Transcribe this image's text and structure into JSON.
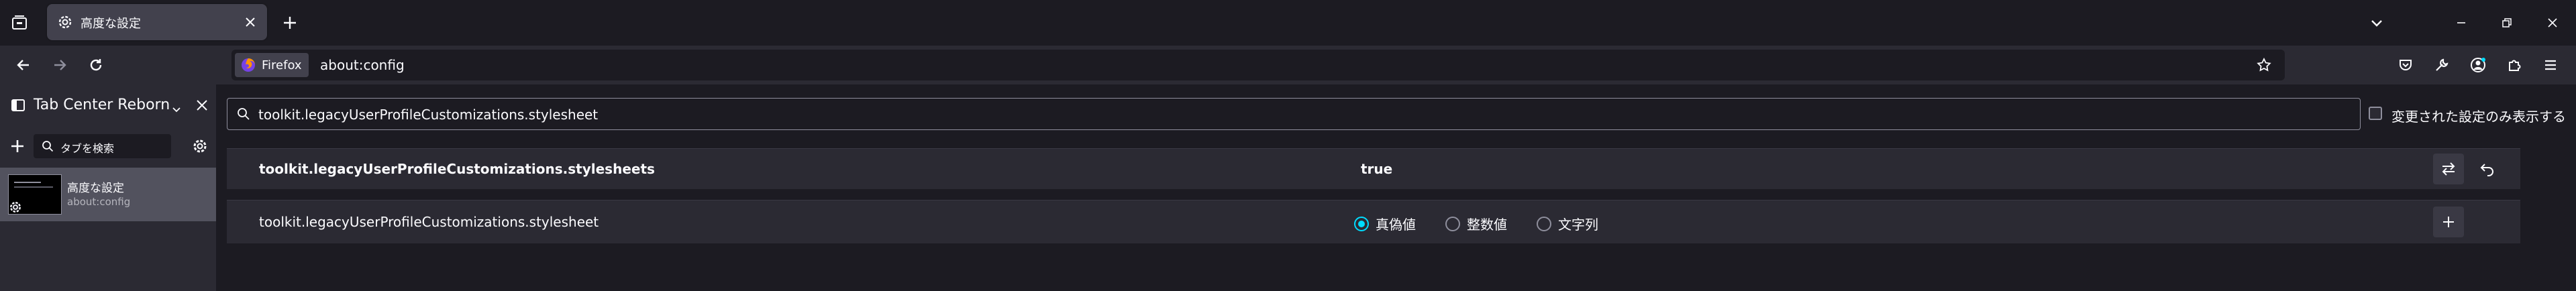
{
  "tab": {
    "title": "高度な設定"
  },
  "urlbar": {
    "identity_label": "Firefox",
    "url": "about:config"
  },
  "sidebar": {
    "title": "Tab Center Reborn",
    "search_placeholder": "タブを検索",
    "tabs": [
      {
        "title": "高度な設定",
        "url": "about:config"
      }
    ]
  },
  "config": {
    "search_value": "toolkit.legacyUserProfileCustomizations.stylesheet",
    "modified_only_label": "変更された設定のみ表示する",
    "rows": [
      {
        "name": "toolkit.legacyUserProfileCustomizations.stylesheets",
        "value": "true"
      },
      {
        "name": "toolkit.legacyUserProfileCustomizations.stylesheet",
        "types": [
          "真偽値",
          "整数値",
          "文字列"
        ],
        "selected_type": "真偽値"
      }
    ]
  },
  "colors": {
    "accent": "#00ddff",
    "toolbar": "#2b2a33",
    "background": "#1c1b22"
  }
}
